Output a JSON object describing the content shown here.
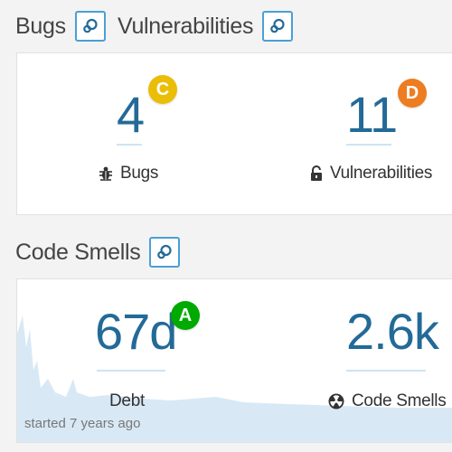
{
  "reliability": {
    "bugs_title": "Bugs",
    "vulnerabilities_title": "Vulnerabilities",
    "bugs": {
      "value": "4",
      "rating": "C",
      "rating_color": "#eabe06",
      "label": "Bugs",
      "icon": "bug-icon"
    },
    "vulnerabilities": {
      "value": "11",
      "rating": "D",
      "rating_color": "#ed7d20",
      "label": "Vulnerabilities",
      "icon": "lock-icon"
    }
  },
  "maintainability": {
    "title": "Code Smells",
    "debt": {
      "value": "67d",
      "rating": "A",
      "rating_color": "#00aa00",
      "label": "Debt"
    },
    "code_smells": {
      "value": "2.6k",
      "label": "Code Smells",
      "icon": "radiation-icon"
    },
    "history_note": "started 7 years ago",
    "sparkline_color": "#d8e9f5"
  }
}
